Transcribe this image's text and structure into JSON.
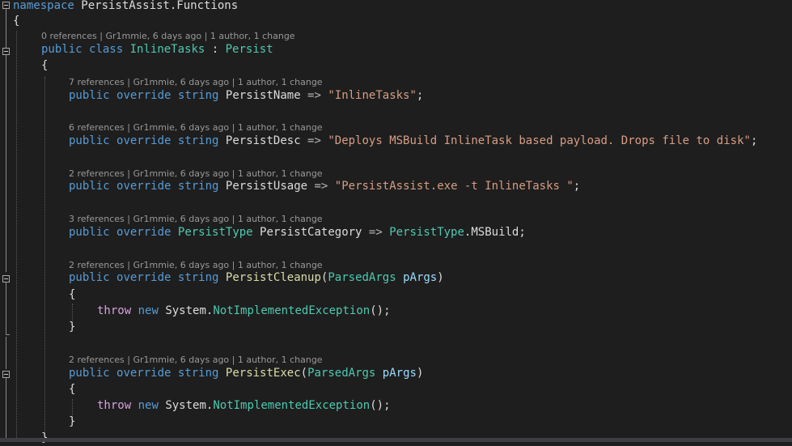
{
  "lens": {
    "class": "0 references | Gr1mmie, 6 days ago | 1 author, 1 change",
    "name": "7 references | Gr1mmie, 6 days ago | 1 author, 1 change",
    "desc": "6 references | Gr1mmie, 6 days ago | 1 author, 1 change",
    "usage": "2 references | Gr1mmie, 6 days ago | 1 author, 1 change",
    "category": "3 references | Gr1mmie, 6 days ago | 1 author, 1 change",
    "cleanup": "2 references | Gr1mmie, 6 days ago | 1 author, 1 change",
    "exec": "2 references | Gr1mmie, 6 days ago | 1 author, 1 change"
  },
  "code": {
    "namespace_kw": "namespace",
    "namespace_name": " PersistAssist.Functions",
    "open_brace": "{",
    "close_brace": "}",
    "public": "public",
    "class": "class",
    "override": "override",
    "string": "string",
    "class_name": "InlineTasks",
    "colon": " : ",
    "base_class": "Persist",
    "arrow": " => ",
    "semicolon": ";",
    "name_prop": "PersistName",
    "name_val": "\"InlineTasks\"",
    "desc_prop": "PersistDesc",
    "desc_val": "\"Deploys MSBuild InlineTask based payload. Drops file to disk\"",
    "usage_prop": "PersistUsage",
    "usage_val": "\"PersistAssist.exe -t InlineTasks \"",
    "persist_type": "PersistType",
    "category_prop": "PersistCategory",
    "msbuild": ".MSBuild",
    "cleanup_method": "PersistCleanup",
    "exec_method": "PersistExec",
    "paren_open": "(",
    "paren_close": ")",
    "parsed_args": "ParsedArgs",
    "param": "pArgs",
    "throw": "throw",
    "new": "new",
    "system": "System",
    "dot": ".",
    "exception": "NotImplementedException",
    "call_end": "();"
  },
  "colors": {
    "background": "#1e1e1e",
    "keyword": "#569cd6",
    "control_keyword": "#d8a0df",
    "type": "#4ec9b0",
    "string": "#d69d85",
    "parameter": "#9cdcfe",
    "codelens": "#999999"
  }
}
